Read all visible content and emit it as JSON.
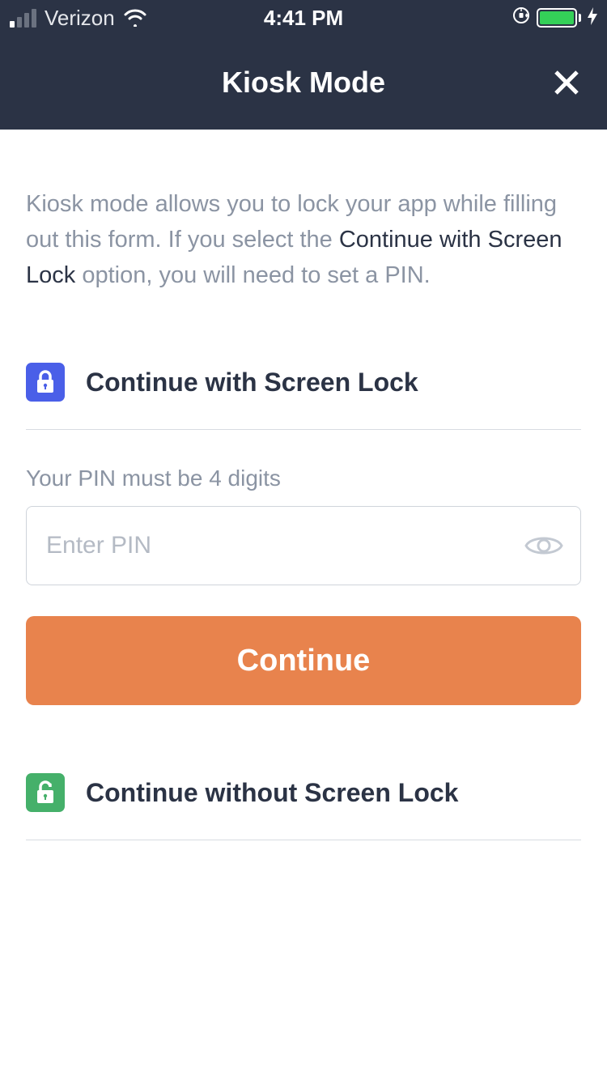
{
  "status": {
    "carrier": "Verizon",
    "time": "4:41 PM"
  },
  "header": {
    "title": "Kiosk Mode"
  },
  "intro": {
    "part1": "Kiosk mode allows you to lock your app while filling out this form. If you select the ",
    "bold": "Continue with Screen Lock",
    "part2": " option, you will need to set a PIN."
  },
  "option_lock": {
    "label": "Continue with Screen Lock"
  },
  "pin": {
    "hint": "Your PIN must be 4 digits",
    "placeholder": "Enter PIN",
    "value": ""
  },
  "continue": {
    "label": "Continue"
  },
  "option_nolock": {
    "label": "Continue without Screen Lock"
  }
}
